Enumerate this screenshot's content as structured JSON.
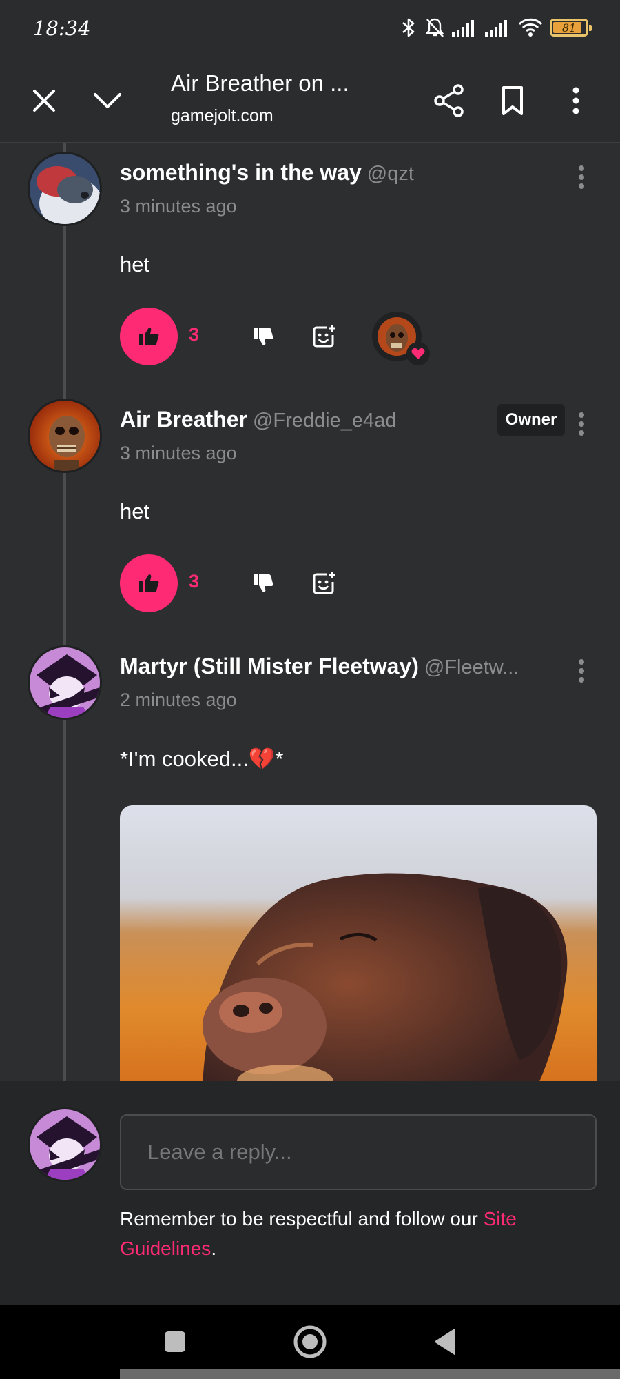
{
  "status_bar": {
    "time": "18:34",
    "battery_percent": "81"
  },
  "browser": {
    "title": "Air Breather on ...",
    "url": "gamejolt.com"
  },
  "comments": [
    {
      "name": "something's in the way",
      "handle": "@qzt",
      "time": "3 minutes ago",
      "text": "het",
      "likes": "3",
      "owner_badge": ""
    },
    {
      "name": "Air Breather",
      "handle": "@Freddie_e4ad",
      "time": "3 minutes ago",
      "text": "het",
      "likes": "3",
      "owner_badge": "Owner"
    },
    {
      "name": "Martyr (Still Mister Fleetway)",
      "handle": "@Fleetw...",
      "time": "2 minutes ago",
      "text": "*I'm cooked...💔*"
    }
  ],
  "reply": {
    "placeholder": "Leave a reply...",
    "note_prefix": "Remember to be respectful and follow our ",
    "note_link": "Site Guidelines",
    "note_suffix": "."
  },
  "colors": {
    "accent": "#ff2a74",
    "background": "#2c2e2f",
    "muted_text": "#8a8c8e"
  },
  "icons": [
    "close-icon",
    "chevron-down-icon",
    "share-icon",
    "bookmark-icon",
    "more-vertical-icon",
    "thumbs-up-icon",
    "thumbs-down-icon",
    "add-reaction-icon",
    "heart-icon",
    "bluetooth-icon",
    "bell-off-icon",
    "signal-icon",
    "wifi-icon",
    "battery-icon",
    "recents-icon",
    "home-icon",
    "back-icon"
  ]
}
